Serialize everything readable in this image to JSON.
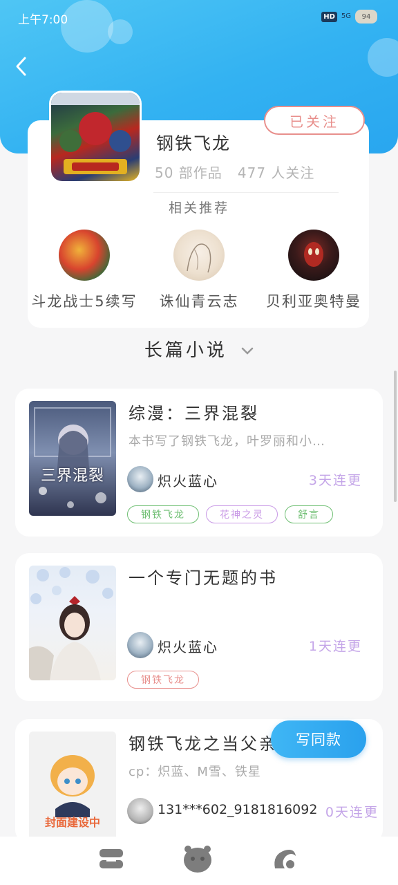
{
  "status_bar": {
    "time": "上午7:00",
    "hd": "HD",
    "signal": "5G",
    "battery": "94"
  },
  "author": {
    "name": "钢铁飞龙",
    "works": "50 部作品",
    "followers": "477 人关注",
    "follow_label": "已关注"
  },
  "recommend": {
    "title": "相关推荐",
    "items": [
      {
        "name": "斗龙战士5续写"
      },
      {
        "name": "诛仙青云志"
      },
      {
        "name": "贝利亚奥特曼"
      }
    ]
  },
  "category": {
    "label": "长篇小说"
  },
  "books": [
    {
      "title": "综漫：三界混裂",
      "desc": "本书写了钢铁飞龙，叶罗丽和小…",
      "cover_text": "三界混裂",
      "writer": "炽火蓝心",
      "update": "3天连更",
      "tags": [
        "钢铁飞龙",
        "花神之灵",
        "舒言"
      ]
    },
    {
      "title": "一个专门无题的书",
      "desc": "",
      "writer": "炽火蓝心",
      "update": "1天连更",
      "tags": [
        "钢铁飞龙"
      ]
    },
    {
      "title": "钢铁飞龙之当父亲",
      "desc": "cp：炽蓝、M雪、铁星",
      "cover_text": "封面建设中",
      "writer": "131***602_9181816092",
      "update": "0天连更",
      "tags": []
    }
  ],
  "write_button": "写同款",
  "colors": {
    "header": "#33b2f2",
    "follow": "#e88f8c",
    "update": "#c4a5e8",
    "tag_green": "#6fbf73",
    "tag_purple": "#c99ae6",
    "tag_red": "#e88f8c"
  }
}
